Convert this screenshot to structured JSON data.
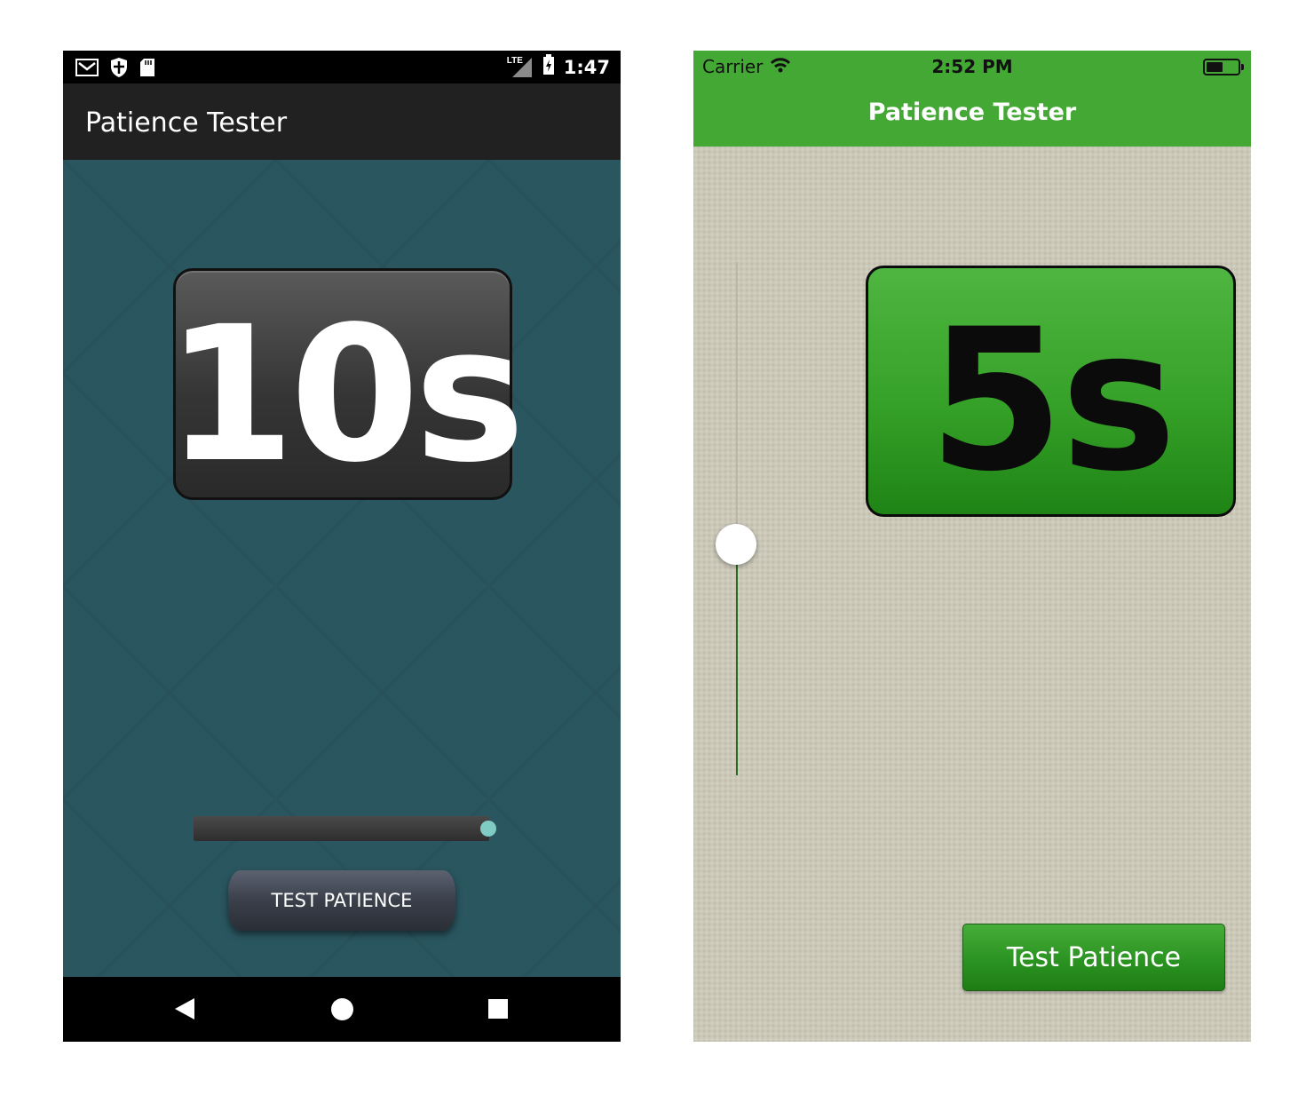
{
  "android": {
    "status_bar": {
      "time": "1:47",
      "network": "LTE",
      "icons": [
        "gmail-icon",
        "shield-icon",
        "sd-card-icon",
        "signal-icon",
        "battery-charging-icon"
      ]
    },
    "app_bar": {
      "title": "Patience Tester"
    },
    "display": {
      "value": "10s"
    },
    "slider": {
      "level_percent": 100,
      "thumb_color": "#80cbc4"
    },
    "button": {
      "label": "TEST PATIENCE"
    },
    "nav_bar": {
      "icons": [
        "back-icon",
        "home-icon",
        "recents-icon"
      ]
    },
    "colors": {
      "background": "#2a5660",
      "app_bar": "#212121"
    }
  },
  "ios": {
    "status_bar": {
      "carrier": "Carrier",
      "time": "2:52 PM",
      "icons": [
        "wifi-icon",
        "battery-icon"
      ]
    },
    "nav_bar": {
      "title": "Patience Tester"
    },
    "display": {
      "value": "5s"
    },
    "slider": {
      "level_percent": 45,
      "orientation": "vertical"
    },
    "button": {
      "label": "Test Patience"
    },
    "colors": {
      "accent": "#44a835",
      "background": "#cbc8b8"
    }
  }
}
